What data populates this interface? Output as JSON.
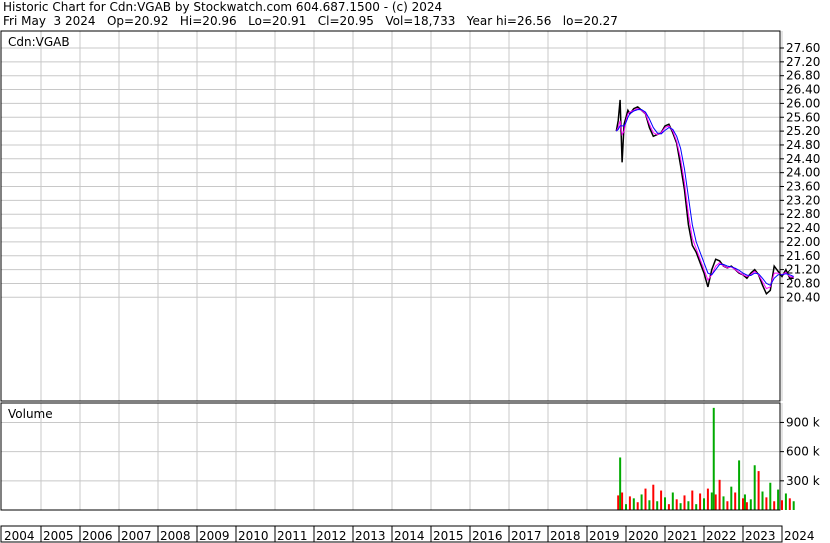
{
  "header": {
    "line1": "Historic Chart for Cdn:VGAB by Stockwatch.com 604.687.1500 - (c) 2024",
    "line2": "Fri May  3 2024   Op=20.92   Hi=20.96   Lo=20.91   Cl=20.95   Vol=18,733   Year hi=26.56   lo=20.27"
  },
  "price_panel": {
    "symbol": "Cdn:VGAB"
  },
  "volume_panel": {
    "title": "Volume"
  },
  "chart_data": [
    {
      "type": "line",
      "name": "price",
      "x_ticks": [
        "2004",
        "2005",
        "2006",
        "2007",
        "2008",
        "2009",
        "2010",
        "2011",
        "2012",
        "2013",
        "2014",
        "2015",
        "2016",
        "2017",
        "2018",
        "2019",
        "2020",
        "2021",
        "2022",
        "2023",
        "2024"
      ],
      "y_ticks": [
        "27.60",
        "27.20",
        "26.80",
        "26.40",
        "26.00",
        "25.60",
        "25.20",
        "24.80",
        "24.40",
        "24.00",
        "23.60",
        "23.20",
        "22.80",
        "22.40",
        "22.00",
        "21.60",
        "21.20",
        "20.80",
        "20.40"
      ],
      "ylim": [
        20.0,
        27.84
      ],
      "grid": true,
      "x": [
        2019.75,
        2019.8,
        2019.85,
        2019.9,
        2019.95,
        2020.0,
        2020.05,
        2020.1,
        2020.2,
        2020.3,
        2020.4,
        2020.5,
        2020.6,
        2020.7,
        2020.8,
        2020.9,
        2021.0,
        2021.1,
        2021.2,
        2021.3,
        2021.4,
        2021.5,
        2021.6,
        2021.7,
        2021.8,
        2021.9,
        2022.0,
        2022.1,
        2022.2,
        2022.3,
        2022.4,
        2022.5,
        2022.6,
        2022.7,
        2022.8,
        2022.9,
        2023.0,
        2023.1,
        2023.2,
        2023.3,
        2023.4,
        2023.5,
        2023.6,
        2023.7,
        2023.8,
        2023.9,
        2024.0,
        2024.1,
        2024.2,
        2024.3
      ],
      "series": [
        {
          "color": "#000000",
          "values": [
            25.2,
            25.5,
            26.1,
            24.3,
            25.4,
            25.6,
            25.8,
            25.7,
            25.85,
            25.9,
            25.8,
            25.7,
            25.3,
            25.05,
            25.1,
            25.15,
            25.35,
            25.4,
            25.15,
            24.85,
            24.2,
            23.5,
            22.5,
            21.9,
            21.7,
            21.4,
            21.1,
            20.7,
            21.2,
            21.5,
            21.45,
            21.3,
            21.25,
            21.3,
            21.2,
            21.1,
            21.05,
            20.95,
            21.1,
            21.2,
            21.05,
            20.75,
            20.5,
            20.6,
            21.3,
            21.15,
            21.0,
            21.2,
            20.95,
            20.95
          ]
        },
        {
          "color": "#ff00ff",
          "values": [
            25.2,
            25.3,
            25.5,
            25.1,
            25.2,
            25.5,
            25.7,
            25.75,
            25.8,
            25.85,
            25.8,
            25.7,
            25.4,
            25.15,
            25.1,
            25.15,
            25.3,
            25.35,
            25.2,
            24.9,
            24.4,
            23.7,
            22.8,
            22.1,
            21.8,
            21.5,
            21.2,
            20.9,
            21.05,
            21.3,
            21.4,
            21.3,
            21.25,
            21.28,
            21.2,
            21.12,
            21.05,
            21.0,
            21.05,
            21.15,
            21.05,
            20.85,
            20.65,
            20.7,
            21.1,
            21.1,
            21.05,
            21.12,
            21.0,
            20.98
          ]
        },
        {
          "color": "#0000ff",
          "values": [
            25.2,
            25.25,
            25.35,
            25.35,
            25.35,
            25.45,
            25.6,
            25.7,
            25.78,
            25.82,
            25.82,
            25.75,
            25.55,
            25.3,
            25.15,
            25.12,
            25.22,
            25.3,
            25.25,
            25.05,
            24.7,
            24.1,
            23.3,
            22.5,
            22.0,
            21.7,
            21.4,
            21.1,
            21.05,
            21.2,
            21.35,
            21.35,
            21.3,
            21.28,
            21.24,
            21.18,
            21.1,
            21.04,
            21.03,
            21.1,
            21.08,
            20.95,
            20.8,
            20.75,
            20.95,
            21.05,
            21.05,
            21.08,
            21.05,
            21.0
          ]
        }
      ]
    },
    {
      "type": "bar",
      "name": "volume",
      "y_ticks": [
        "900 k",
        "600 k",
        "300 k"
      ],
      "ylim": [
        0,
        1100
      ],
      "grid": true,
      "x": [
        2019.8,
        2019.85,
        2019.9,
        2020.0,
        2020.1,
        2020.2,
        2020.3,
        2020.4,
        2020.5,
        2020.6,
        2020.7,
        2020.8,
        2020.9,
        2021.0,
        2021.1,
        2021.2,
        2021.3,
        2021.4,
        2021.5,
        2021.6,
        2021.7,
        2021.8,
        2021.9,
        2022.0,
        2022.1,
        2022.2,
        2022.25,
        2022.3,
        2022.4,
        2022.5,
        2022.6,
        2022.7,
        2022.8,
        2022.9,
        2023.0,
        2023.05,
        2023.1,
        2023.2,
        2023.3,
        2023.4,
        2023.5,
        2023.6,
        2023.7,
        2023.8,
        2023.9,
        2024.0,
        2024.1,
        2024.2,
        2024.3
      ],
      "values": [
        150,
        540,
        180,
        60,
        140,
        120,
        80,
        160,
        220,
        100,
        260,
        90,
        200,
        130,
        60,
        180,
        110,
        70,
        150,
        90,
        200,
        60,
        170,
        120,
        220,
        180,
        1050,
        160,
        310,
        140,
        90,
        240,
        180,
        510,
        120,
        160,
        80,
        110,
        460,
        400,
        190,
        130,
        280,
        90,
        210,
        100,
        170,
        120,
        90
      ],
      "colors": [
        "#ff0000",
        "#00aa00",
        "#ff0000",
        "#00aa00",
        "#ff0000",
        "#00aa00",
        "#ff0000",
        "#00aa00",
        "#ff0000",
        "#00aa00",
        "#ff0000",
        "#00aa00",
        "#ff0000",
        "#00aa00",
        "#ff0000",
        "#00aa00",
        "#ff0000",
        "#00aa00",
        "#ff0000",
        "#00aa00",
        "#ff0000",
        "#00aa00",
        "#ff0000",
        "#00aa00",
        "#ff0000",
        "#00aa00",
        "#00aa00",
        "#ff0000",
        "#ff0000",
        "#00aa00",
        "#ff0000",
        "#00aa00",
        "#ff0000",
        "#00aa00",
        "#ff0000",
        "#00aa00",
        "#ff0000",
        "#00aa00",
        "#00aa00",
        "#ff0000",
        "#00aa00",
        "#ff0000",
        "#00aa00",
        "#ff0000",
        "#00aa00",
        "#ff0000",
        "#00aa00",
        "#ff0000",
        "#00aa00"
      ]
    }
  ]
}
